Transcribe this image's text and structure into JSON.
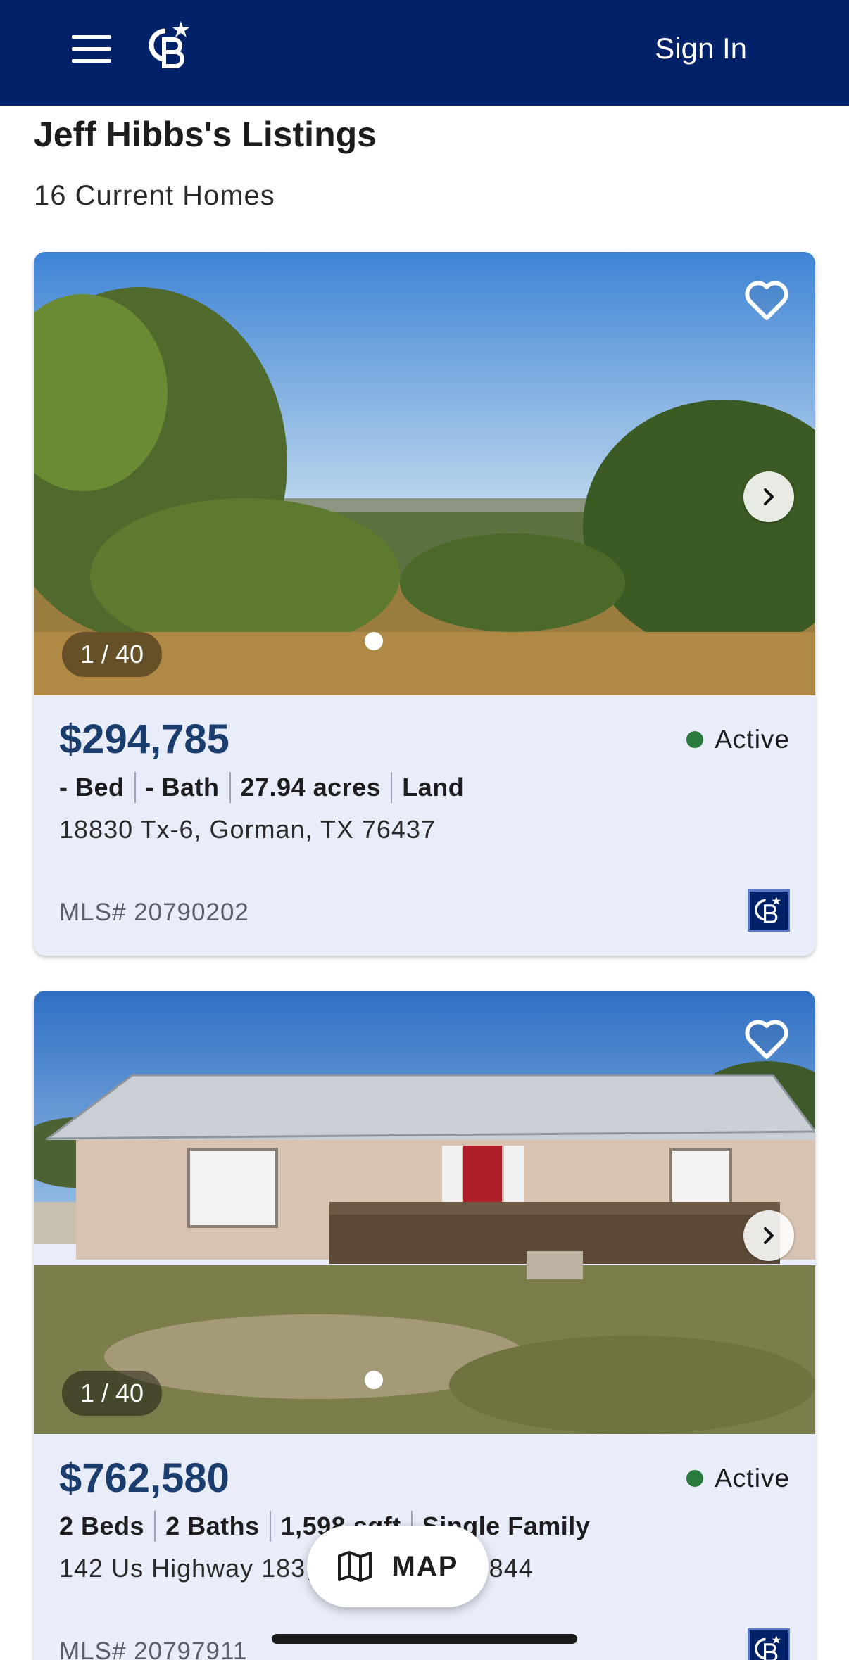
{
  "header": {
    "sign_in_label": "Sign In",
    "brand_color": "#012169"
  },
  "page": {
    "title": "Jeff Hibbs's Listings",
    "count": "16 Current Homes"
  },
  "listings": [
    {
      "photo_counter": "1 / 40",
      "price": "$294,785",
      "status": "Active",
      "specs": [
        "- Bed",
        "- Bath",
        "27.94 acres",
        "Land"
      ],
      "address": "18830 Tx-6, Gorman, TX 76437",
      "mls": "MLS# 20790202"
    },
    {
      "photo_counter": "1 / 40",
      "price": "$762,580",
      "status": "Active",
      "specs": [
        "2 Beds",
        "2 Baths",
        "1,598 sqft",
        "Single Family"
      ],
      "address": "142 Us Highway 183, Zephyr, TX 76844",
      "mls": "MLS# 20797911"
    }
  ],
  "map_button": {
    "label": "MAP"
  },
  "colors": {
    "price": "#1b3d6d",
    "active_dot": "#2b7a3d",
    "card_bg": "#e8edf9"
  },
  "icons": [
    "menu-icon",
    "coldwell-banker-logo",
    "heart-icon",
    "chevron-right-icon",
    "map-icon"
  ]
}
